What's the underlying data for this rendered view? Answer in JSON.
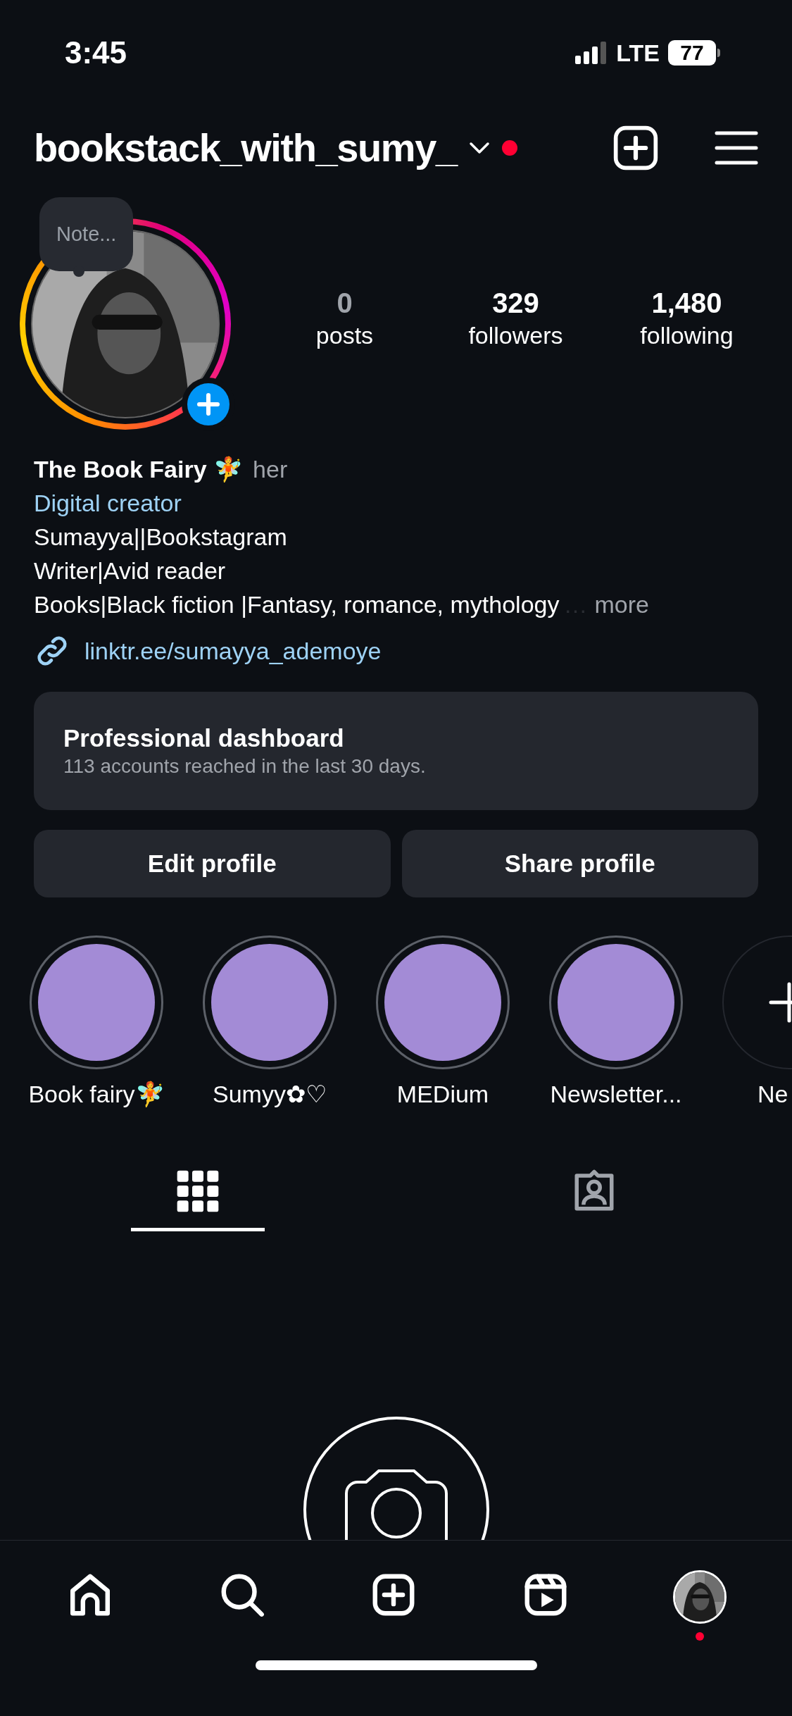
{
  "status_bar": {
    "time": "3:45",
    "network": "LTE",
    "battery": "77"
  },
  "header": {
    "username": "bookstack_with_sumy_",
    "has_notification": true
  },
  "profile": {
    "note": "Note...",
    "stats": [
      {
        "value": "0",
        "label": "posts",
        "dim": true
      },
      {
        "value": "329",
        "label": "followers",
        "dim": false
      },
      {
        "value": "1,480",
        "label": "following",
        "dim": false
      }
    ],
    "name": "The Book Fairy 🧚",
    "pronouns": "her",
    "category": "Digital creator",
    "bio": [
      "Sumayya||Bookstagram",
      "Writer|Avid reader",
      "Books|Black fiction |Fantasy, romance, mythology"
    ],
    "bio_ellipsis": "…",
    "more": "more",
    "link": "linktr.ee/sumayya_ademoye"
  },
  "dashboard": {
    "title": "Professional dashboard",
    "subtitle": "113 accounts reached in the last 30 days."
  },
  "buttons": [
    "Edit profile",
    "Share profile"
  ],
  "highlights": [
    {
      "kind": "highlight",
      "label": "Book fairy🧚",
      "color": "#a38bd6"
    },
    {
      "kind": "highlight",
      "label": "Sumyy✿♡",
      "color": "#a38bd6"
    },
    {
      "kind": "highlight",
      "label": "MEDium",
      "color": "#a38bd6"
    },
    {
      "kind": "highlight",
      "label": "Newsletter...",
      "color": "#a38bd6"
    },
    {
      "kind": "new",
      "label": "Ne"
    }
  ],
  "tabs": [
    {
      "kind": "grid",
      "selected": true
    },
    {
      "kind": "tagged",
      "selected": false
    }
  ],
  "nav": [
    {
      "kind": "home"
    },
    {
      "kind": "search"
    },
    {
      "kind": "create"
    },
    {
      "kind": "reels"
    },
    {
      "kind": "profile",
      "has_notification": true
    }
  ]
}
